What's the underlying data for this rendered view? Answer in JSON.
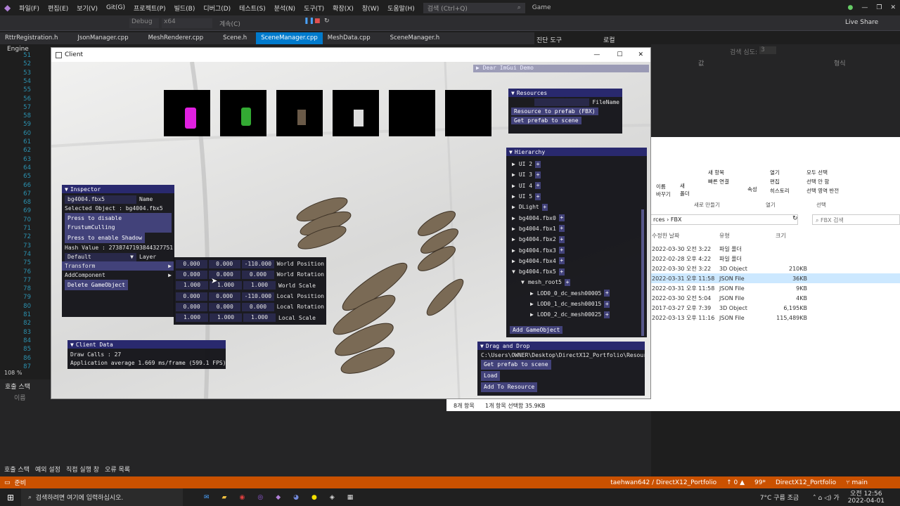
{
  "menu": [
    "파일(F)",
    "편집(E)",
    "보기(V)",
    "Git(G)",
    "프로젝트(P)",
    "빌드(B)",
    "디버그(D)",
    "테스트(S)",
    "분석(N)",
    "도구(T)",
    "확장(X)",
    "창(W)",
    "도움말(H)"
  ],
  "search_placeholder": "검색 (Ctrl+Q)",
  "solution": "Game",
  "live_share": "Live Share",
  "config": "Debug",
  "platform": "x64",
  "continue": "계속(C)",
  "tabs": [
    "RttrRegistration.h",
    "JsonManager.cpp",
    "MeshRenderer.cpp",
    "Scene.h",
    "SceneManager.cpp",
    "MeshData.cpp",
    "SceneManager.h"
  ],
  "side_tabs": [
    "진단 도구",
    "로컬"
  ],
  "search_depth": "검색 심도:",
  "search_depth_val": "3",
  "col_value": "값",
  "col_format": "형식",
  "project_dropdown": "Engine",
  "line_numbers": [
    51,
    52,
    53,
    54,
    55,
    56,
    57,
    58,
    59,
    60,
    61,
    62,
    63,
    64,
    65,
    66,
    67,
    68,
    69,
    70,
    71,
    72,
    73,
    74,
    75,
    76,
    77,
    78,
    79,
    80,
    81,
    82,
    83,
    84,
    85,
    86,
    87
  ],
  "zoom": "108 %",
  "callstack": "호출 스택",
  "callstack_col": "이름",
  "bottom_tabs": [
    "호출 스택",
    "예외 설정",
    "직접 실행 창",
    "오류 목록"
  ],
  "status": {
    "ready": "준비",
    "repo": "taehwan642 / DirectX12_Portfolio",
    "arrows": "↑ 0 ▲",
    "edits": "99*",
    "branch_repo": "DirectX12_Portfolio",
    "branch": "main"
  },
  "client": {
    "title": "Client",
    "dear_imgui": "Dear ImGui Demo"
  },
  "resources": {
    "title": "Resources",
    "field_label": "FileName",
    "btn1": "Resource to prefab (FBX)",
    "btn2": "Get prefab to scene"
  },
  "hierarchy": {
    "title": "Hierarchy",
    "items": [
      "UI 2",
      "UI 3",
      "UI 4",
      "UI 5",
      "DLight",
      "bg4004.fbx0",
      "bg4004.fbx1",
      "bg4004.fbx2",
      "bg4004.fbx3",
      "bg4004.fbx4",
      "bg4004.fbx5"
    ],
    "child": "mesh_root5",
    "grandchildren": [
      "LOD0_0_dc_mesh00005",
      "LOD0_1_dc_mesh00015",
      "LOD0_2_dc_mesh00025"
    ],
    "add": "Add GameObject"
  },
  "inspector": {
    "title": "Inspector",
    "name_value": "bg4004.fbx5",
    "name_label": "Name",
    "selected": "Selected Object : bg4004.fbx5",
    "btn_frustum": "Press to disable FrustumCulling",
    "btn_shadow": "Press to enable Shadow",
    "hash": "Hash Value : 2738747193844327751",
    "layer_value": "Default",
    "layer_label": "Layer",
    "transform": "Transform",
    "add_component": "AddComponent",
    "delete": "Delete GameObject"
  },
  "transform": [
    {
      "x": "0.000",
      "y": "0.000",
      "z": "-110.000",
      "label": "World Position"
    },
    {
      "x": "0.000",
      "y": "0.000",
      "z": "0.000",
      "label": "World Rotation"
    },
    {
      "x": "1.000",
      "y": "1.000",
      "z": "1.000",
      "label": "World Scale"
    },
    {
      "x": "0.000",
      "y": "0.000",
      "z": "-110.000",
      "label": "Local Position"
    },
    {
      "x": "0.000",
      "y": "0.000",
      "z": "0.000",
      "label": "Local Rotation"
    },
    {
      "x": "1.000",
      "y": "1.000",
      "z": "1.000",
      "label": "Local Scale"
    }
  ],
  "client_data": {
    "title": "Client Data",
    "draw_calls": "Draw Calls : 27",
    "average": "Application average 1.669 ms/frame (599.1 FPS)"
  },
  "drag_drop": {
    "title": "Drag and Drop",
    "path": "C:\\Users\\OWNER\\Desktop\\DirectX12_Portfolio\\Resour",
    "btn1": "Get prefab to scene",
    "btn2": "Load",
    "btn3": "Add To Resource"
  },
  "explorer": {
    "ribbon": {
      "rename": "이름 바꾸기",
      "new_folder": "새 폴더",
      "new_item": "새 항목",
      "easy_access": "빠른 연결",
      "properties": "속성",
      "open": "열기",
      "edit": "편집",
      "history": "히스토리",
      "select_all": "모두 선택",
      "select_none": "선택 안 함",
      "invert": "선택 영역 반전",
      "new_group": "새로 만들기",
      "open_group": "열기",
      "select_group": "선택"
    },
    "path_prefix": "rces",
    "path_folder": "FBX",
    "search": "FBX 검색",
    "col_date": "수정한 날짜",
    "col_type": "유형",
    "col_size": "크기",
    "files": [
      {
        "date": "2022-03-30 오전 3:22",
        "type": "파일 폴더",
        "size": ""
      },
      {
        "date": "2022-02-28 오후 4:22",
        "type": "파일 폴더",
        "size": ""
      },
      {
        "date": "2022-03-30 오전 3:22",
        "type": "3D Object",
        "size": "210KB"
      },
      {
        "date": "2022-03-31 오후 11:58",
        "type": "JSON File",
        "size": "36KB"
      },
      {
        "date": "2022-03-31 오후 11:58",
        "type": "JSON File",
        "size": "9KB"
      },
      {
        "date": "2022-03-30 오전 5:04",
        "type": "JSON File",
        "size": "4KB"
      },
      {
        "date": "2017-03-27 오후 7:39",
        "type": "3D Object",
        "size": "6,195KB"
      },
      {
        "date": "2022-03-13 오후 11:16",
        "type": "JSON File",
        "size": "115,489KB"
      }
    ],
    "status_count": "8개 항목",
    "status_selected": "1개 항목 선택함 35.9KB"
  },
  "taskbar": {
    "search": "검색하려면 여기에 입력하십시오.",
    "weather": "7°C 구름 조금",
    "time": "오전 12:56",
    "date": "2022-04-01"
  }
}
